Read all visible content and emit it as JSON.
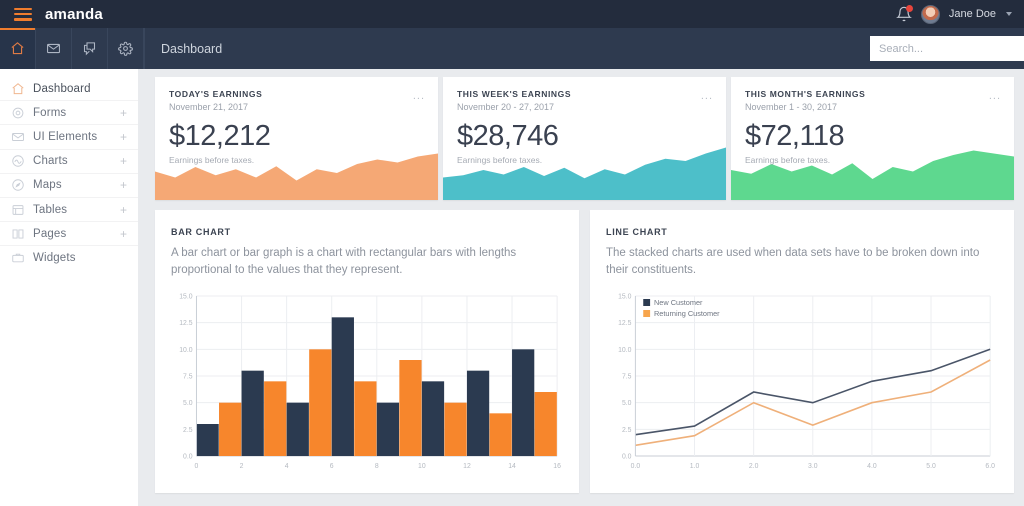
{
  "brand": {
    "name": "amanda",
    "menu_icon": "hamburger-icon",
    "accent": "#f07d2e"
  },
  "topbar": {
    "notifications_icon": "bell-icon",
    "has_notification": true,
    "user_name": "Jane Doe",
    "user_caret": "chevron-down-icon"
  },
  "navbar": {
    "icons": [
      "home-icon",
      "mail-icon",
      "chat-icon",
      "gear-icon"
    ],
    "breadcrumb": "Dashboard",
    "search": {
      "placeholder": "Search...",
      "value": "",
      "button_icon": "search-icon"
    }
  },
  "sidebar": {
    "items": [
      {
        "label": "Dashboard",
        "icon": "home-icon",
        "expandable": false,
        "active": true
      },
      {
        "label": "Forms",
        "icon": "gear-icon",
        "expandable": true,
        "active": false
      },
      {
        "label": "UI Elements",
        "icon": "inbox-icon",
        "expandable": true,
        "active": false
      },
      {
        "label": "Charts",
        "icon": "chart-circle-icon",
        "expandable": true,
        "active": false
      },
      {
        "label": "Maps",
        "icon": "compass-icon",
        "expandable": true,
        "active": false
      },
      {
        "label": "Tables",
        "icon": "table-icon",
        "expandable": true,
        "active": false
      },
      {
        "label": "Pages",
        "icon": "book-icon",
        "expandable": true,
        "active": false
      },
      {
        "label": "Widgets",
        "icon": "briefcase-icon",
        "expandable": false,
        "active": false
      }
    ],
    "expand_symbol": "+"
  },
  "cards": [
    {
      "title": "TODAY'S EARNINGS",
      "date": "November 21, 2017",
      "amount": "$12,212",
      "subtitle": "Earnings before taxes.",
      "menu": "...",
      "color": "#f5a875",
      "spark": [
        38,
        30,
        44,
        33,
        41,
        30,
        45,
        26,
        41,
        36,
        48,
        54,
        50,
        58,
        62
      ]
    },
    {
      "title": "THIS WEEK'S EARNINGS",
      "date": "November 20 - 27, 2017",
      "amount": "$28,746",
      "subtitle": "Earnings before taxes.",
      "menu": "...",
      "color": "#4dbfc9",
      "spark": [
        30,
        33,
        40,
        34,
        44,
        32,
        43,
        29,
        41,
        34,
        47,
        55,
        52,
        62,
        70
      ]
    },
    {
      "title": "THIS MONTH'S EARNINGS",
      "date": "November 1 - 30, 2017",
      "amount": "$72,118",
      "subtitle": "Earnings before taxes.",
      "menu": "...",
      "color": "#5ed88f",
      "spark": [
        40,
        35,
        48,
        38,
        46,
        34,
        49,
        28,
        44,
        38,
        52,
        60,
        66,
        62,
        58
      ]
    }
  ],
  "panels": [
    {
      "title": "BAR CHART",
      "description": "A bar chart or bar graph is a chart with rectangular bars with lengths proportional to the values that they represent."
    },
    {
      "title": "LINE CHART",
      "description": "The stacked charts are used when data sets have to be broken down into their constituents."
    }
  ],
  "chart_data": [
    {
      "type": "bar",
      "title": "BAR CHART",
      "xlabel": "",
      "ylabel": "",
      "categories": [
        0,
        1,
        2,
        3,
        4,
        5,
        6,
        7,
        8,
        9,
        10,
        11,
        12,
        13,
        14,
        15
      ],
      "values": [
        3,
        5,
        8,
        7,
        5,
        10,
        13,
        7,
        5,
        9,
        7,
        5,
        8,
        4,
        10,
        6
      ],
      "bar_colors": [
        "#2b3a50",
        "#f7862c",
        "#2b3a50",
        "#f7862c",
        "#2b3a50",
        "#f7862c",
        "#2b3a50",
        "#f7862c",
        "#2b3a50",
        "#f7862c",
        "#2b3a50",
        "#f7862c",
        "#2b3a50",
        "#f7862c",
        "#2b3a50",
        "#f7862c"
      ],
      "xlim": [
        0,
        16
      ],
      "ylim": [
        0,
        15
      ],
      "xticks": [
        0,
        2,
        4,
        6,
        8,
        10,
        12,
        14,
        16
      ],
      "xticklabels": [
        "0",
        "2",
        "4",
        "6",
        "8",
        "10",
        "12",
        "14",
        "16"
      ],
      "yticks": [
        0,
        2.5,
        5,
        7.5,
        10,
        12.5,
        15
      ],
      "yticklabels": [
        "0.0",
        "2.5",
        "5.0",
        "7.5",
        "10.0",
        "12.5",
        "15.0"
      ],
      "grid": true,
      "legend": false
    },
    {
      "type": "line",
      "title": "LINE CHART",
      "xlabel": "",
      "ylabel": "",
      "x": [
        0,
        1,
        2,
        3,
        4,
        5,
        6
      ],
      "series": [
        {
          "name": "New Customer",
          "color": "#4a5568",
          "values": [
            2,
            2.8,
            6,
            5,
            7,
            8,
            10
          ]
        },
        {
          "name": "Returning Customer",
          "color": "#efb07a",
          "values": [
            1,
            1.9,
            5,
            2.9,
            5,
            6,
            9
          ]
        }
      ],
      "legend_colors": [
        "#2b3a50",
        "#f7a košt"
      ],
      "xlim": [
        0,
        6
      ],
      "ylim": [
        0,
        15
      ],
      "xticks": [
        0,
        1,
        2,
        3,
        4,
        5,
        6
      ],
      "xticklabels": [
        "0.0",
        "1.0",
        "2.0",
        "3.0",
        "4.0",
        "5.0",
        "6.0"
      ],
      "yticks": [
        0,
        2.5,
        5,
        7.5,
        10,
        12.5,
        15
      ],
      "yticklabels": [
        "0.0",
        "2.5",
        "5.0",
        "7.5",
        "10.0",
        "12.5",
        "15.0"
      ],
      "grid": true,
      "legend": true,
      "legend_position": "top-left"
    }
  ]
}
